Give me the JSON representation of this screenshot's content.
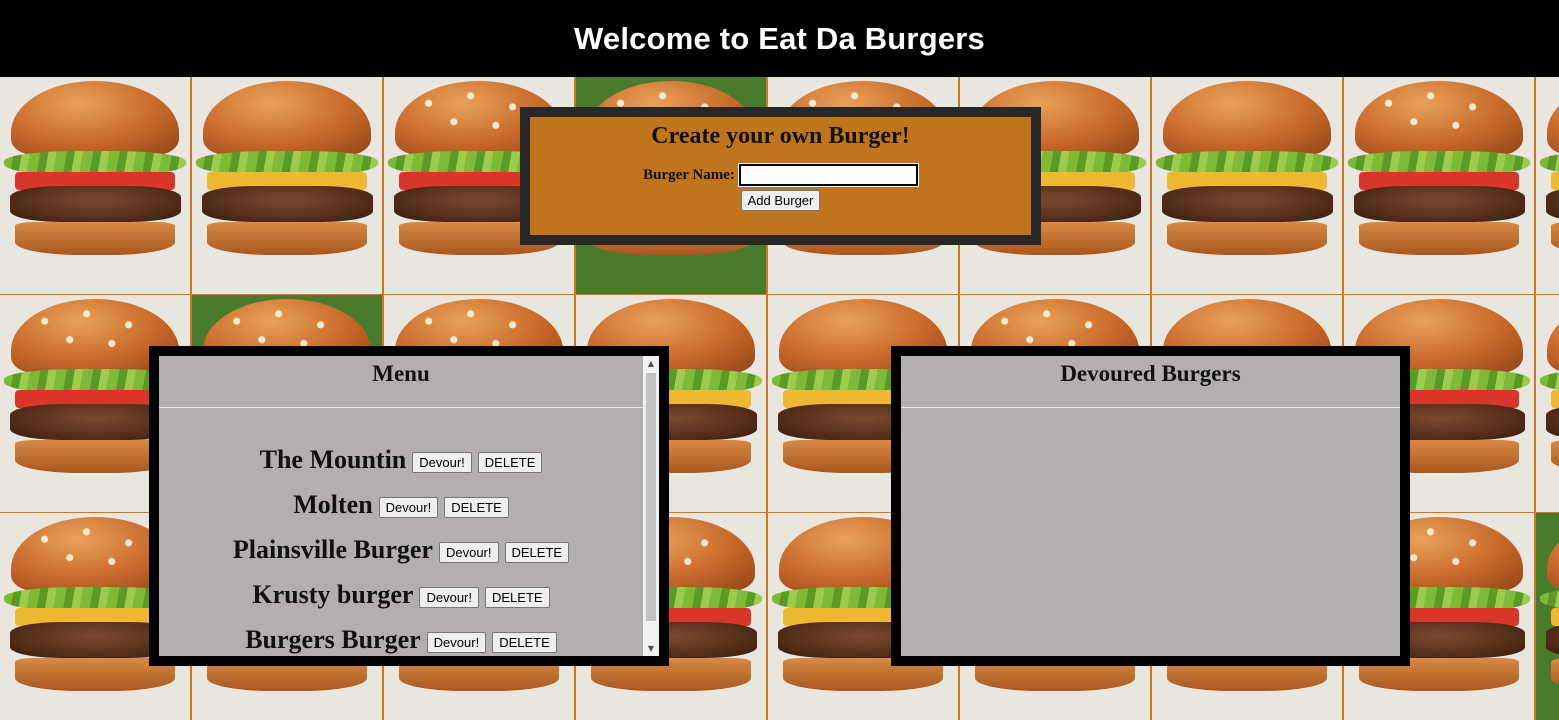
{
  "header": {
    "title": "Welcome to Eat Da Burgers"
  },
  "create_form": {
    "title": "Create your own Burger!",
    "label": "Burger Name:",
    "input_value": "",
    "button_label": "Add Burger"
  },
  "menu": {
    "title": "Menu",
    "items": [
      {
        "name": "The Mountin",
        "devour_label": "Devour!",
        "delete_label": "DELETE"
      },
      {
        "name": "Molten",
        "devour_label": "Devour!",
        "delete_label": "DELETE"
      },
      {
        "name": "Plainsville Burger",
        "devour_label": "Devour!",
        "delete_label": "DELETE"
      },
      {
        "name": "Krusty burger",
        "devour_label": "Devour!",
        "delete_label": "DELETE"
      },
      {
        "name": "Burgers Burger",
        "devour_label": "Devour!",
        "delete_label": "DELETE"
      }
    ]
  },
  "devoured": {
    "title": "Devoured Burgers",
    "items": []
  },
  "colors": {
    "header_bg": "#000000",
    "form_bg": "#c0751d",
    "panel_bg": "#b3afaf"
  }
}
